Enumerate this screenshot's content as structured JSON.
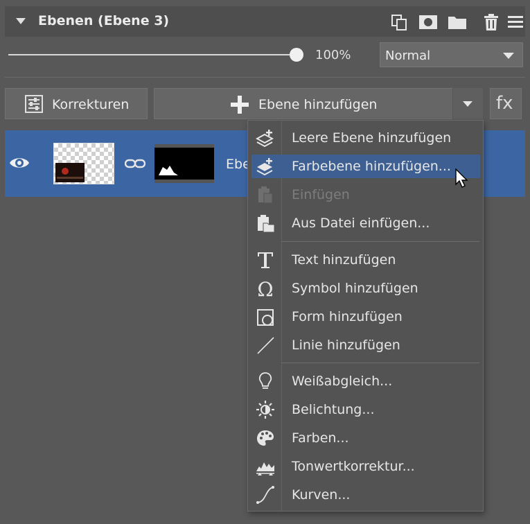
{
  "header": {
    "title": "Ebenen (Ebene 3)",
    "icons": [
      "duplicate-layer-icon",
      "mask-icon",
      "folder-icon",
      "trash-icon",
      "hamburger-menu-icon"
    ]
  },
  "opacity": {
    "value": 1.0,
    "label": "100%"
  },
  "blend_mode": {
    "selected": "Normal"
  },
  "toolbar": {
    "korrekturen_label": "Korrekturen",
    "add_layer_label": "Ebene hinzufügen",
    "fx_label": "fx"
  },
  "layer": {
    "name": "Ebe",
    "visible": true
  },
  "menu": {
    "items": [
      {
        "label": "Leere Ebene hinzufügen",
        "icon": "empty-layer-add-icon",
        "enabled": true,
        "highlighted": false
      },
      {
        "label": "Farbebene hinzufügen...",
        "icon": "color-layer-add-icon",
        "enabled": true,
        "highlighted": true
      },
      {
        "label": "Einfügen",
        "icon": "paste-icon",
        "enabled": false,
        "highlighted": false
      },
      {
        "label": "Aus Datei einfügen...",
        "icon": "paste-from-file-icon",
        "enabled": true,
        "highlighted": false
      },
      {
        "label": "Text hinzufügen",
        "icon": "text-icon",
        "enabled": true,
        "highlighted": false
      },
      {
        "label": "Symbol hinzufügen",
        "icon": "omega-symbol-icon",
        "enabled": true,
        "highlighted": false
      },
      {
        "label": "Form hinzufügen",
        "icon": "shape-icon",
        "enabled": true,
        "highlighted": false
      },
      {
        "label": "Linie hinzufügen",
        "icon": "line-icon",
        "enabled": true,
        "highlighted": false
      },
      {
        "label": "Weißabgleich...",
        "icon": "lightbulb-icon",
        "enabled": true,
        "highlighted": false
      },
      {
        "label": "Belichtung...",
        "icon": "exposure-sun-icon",
        "enabled": true,
        "highlighted": false
      },
      {
        "label": "Farben...",
        "icon": "palette-icon",
        "enabled": true,
        "highlighted": false
      },
      {
        "label": "Tonwertkorrektur...",
        "icon": "levels-histogram-icon",
        "enabled": true,
        "highlighted": false
      },
      {
        "label": "Kurven...",
        "icon": "curves-icon",
        "enabled": true,
        "highlighted": false
      }
    ]
  },
  "colors": {
    "accent": "#3c65a3",
    "menu_highlight": "#3d5f92",
    "panel_bg": "#585858"
  }
}
